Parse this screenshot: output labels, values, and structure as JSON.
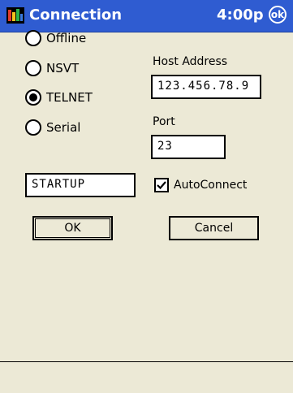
{
  "titlebar": {
    "title": "Connection",
    "time": "4:00p",
    "ok_label": "ok",
    "color": "#2f5cd1"
  },
  "connection_types": [
    {
      "label": "Offline",
      "selected": false
    },
    {
      "label": "NSVT",
      "selected": false
    },
    {
      "label": "TELNET",
      "selected": true
    },
    {
      "label": "Serial",
      "selected": false
    }
  ],
  "startup_field": {
    "value": "STARTUP"
  },
  "host": {
    "label": "Host Address",
    "value": "123.456.78.9"
  },
  "port": {
    "label": "Port",
    "value": "23"
  },
  "autoconnect": {
    "label": "AutoConnect",
    "checked": true
  },
  "buttons": {
    "ok": "OK",
    "cancel": "Cancel"
  }
}
